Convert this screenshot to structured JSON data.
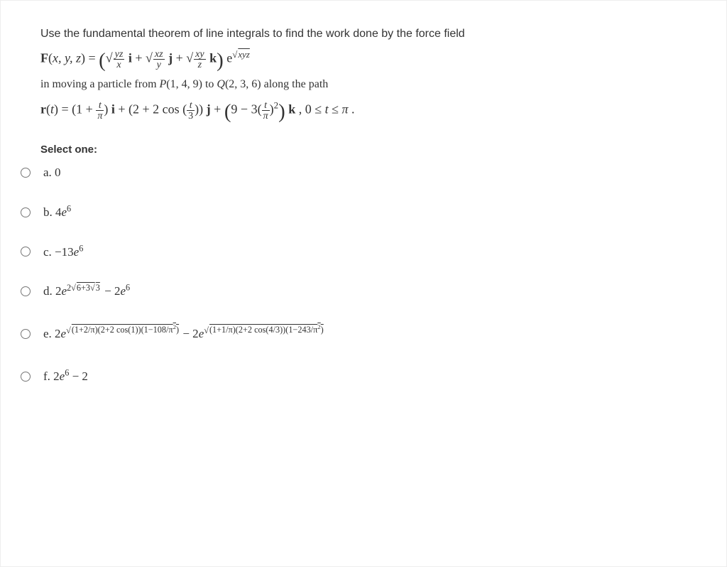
{
  "question": {
    "intro": "Use the fundamental theorem of line integrals to find the work done by the force field",
    "force_field_html": "<b>F</b>(<i>x, y, z</i>) = <span class='big-par'>(</span>&#8730;<span class='sqrt-bar'><span class='frac'><span class='n'><i>yz</i></span><span class='d'><i>x</i></span></span></span> <b>i</b> + &#8730;<span class='sqrt-bar'><span class='frac'><span class='n'><i>xz</i></span><span class='d'><i>y</i></span></span></span> <b>j</b> + &#8730;<span class='sqrt-bar'><span class='frac'><span class='n'><i>xy</i></span><span class='d'><i>z</i></span></span></span> <b>k</b><span class='big-par'>)</span> e<sup>&#8730;<span class='sqrt-bar'><i>xyz</i></span></sup>",
    "particle_text_html": "in moving a particle from <i>P</i>(1, 4, 9) to <i>Q</i>(2, 3, 6) along the path",
    "path_html": "<b>r</b>(<i>t</i>) = (1 + <span class='frac'><span class='n'><i>t</i></span><span class='d'><i>&pi;</i></span></span>) <b>i</b> + (2 + 2 cos (<span class='frac'><span class='n'><i>t</i></span><span class='d'>3</span></span>)) <b>j</b> + <span class='big-par'>(</span>9 &minus; 3(<span class='frac'><span class='n'><i>t</i></span><span class='d'><i>&pi;</i></span></span>)<sup>2</sup><span class='big-par'>)</span> <b>k</b> , 0 &le; <i>t</i> &le; <i>&pi;</i> ."
  },
  "select_one_label": "Select one:",
  "options": {
    "a": "a. 0",
    "b": "b. 4<i>e</i><sup>6</sup>",
    "c": "c. &minus;13<i>e</i><sup>6</sup>",
    "d": "d. 2<i>e</i><sup>2&#8730;<span class='sqrt-bar'>6+3&#8730;<span class='sqrt-bar'>3</span></span></sup> &minus; 2<i>e</i><sup>6</sup>",
    "e": "e. 2<i>e</i><sup>&#8730;<span class='sqrt-bar'>(1+2/&pi;)(2+2 cos(1))(1&minus;108/&pi;<sup>2</sup>)</span></sup> &minus; 2<i>e</i><sup>&#8730;<span class='sqrt-bar'>(1+1/&pi;)(2+2 cos(4/3))(1&minus;243/&pi;<sup>2</sup>)</span></sup>",
    "f": "f. 2<i>e</i><sup>6</sup> &minus; 2"
  }
}
